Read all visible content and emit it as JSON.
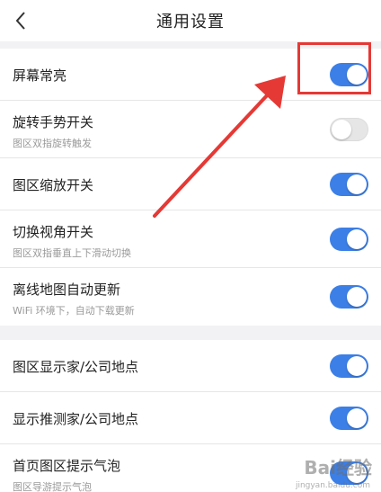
{
  "header": {
    "title": "通用设置",
    "back_icon": "chevron-left-icon"
  },
  "settings_group_1": [
    {
      "title": "屏幕常亮",
      "subtitle": "",
      "enabled": true
    },
    {
      "title": "旋转手势开关",
      "subtitle": "图区双指旋转触发",
      "enabled": false
    },
    {
      "title": "图区缩放开关",
      "subtitle": "",
      "enabled": true
    },
    {
      "title": "切换视角开关",
      "subtitle": "图区双指垂直上下滑动切换",
      "enabled": true
    },
    {
      "title": "离线地图自动更新",
      "subtitle": "WiFi 环境下，自动下载更新",
      "enabled": true
    }
  ],
  "settings_group_2": [
    {
      "title": "图区显示家/公司地点",
      "subtitle": "",
      "enabled": true
    },
    {
      "title": "显示推测家/公司地点",
      "subtitle": "",
      "enabled": true
    },
    {
      "title": "首页图区提示气泡",
      "subtitle": "图区导游提示气泡",
      "enabled": true
    }
  ],
  "annotation": {
    "box_color": "#e53935",
    "arrow_color": "#e53935"
  },
  "watermark": {
    "text": "Bai经验",
    "sub": "jingyan.baidu.com"
  },
  "colors": {
    "toggle_on": "#3c7fe6",
    "toggle_off": "#e6e6e6"
  }
}
